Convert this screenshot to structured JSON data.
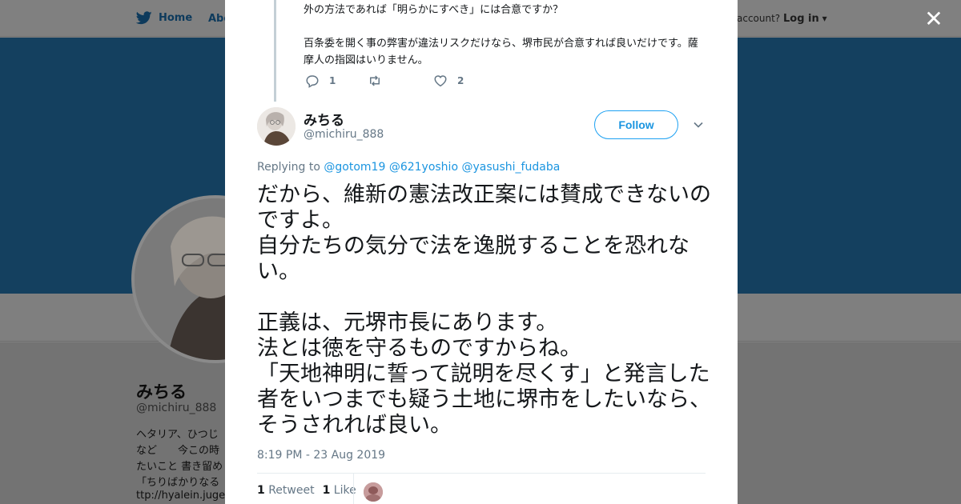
{
  "nav": {
    "home_label": "Home",
    "about_label": "Abo",
    "login_prefix": "account?",
    "login_label": "Log in"
  },
  "profile": {
    "name": "みちる",
    "handle": "@michiru_888",
    "bio": "ヘタリア、ひつじ\nなど　　今この時\nたいこと 書き留め\n「ちりばかりなる",
    "url": "ttp://hyalein.jugem"
  },
  "prev_tweet": {
    "text": "外の方法であれば「明らかにすべき」には合意ですか？\n\n百条委を開く事の弊害が違法リスクだけなら、堺市民が合意すれば良いだけです。薩摩人の指図はいりません。",
    "reply_count": "1",
    "retweet_count": "",
    "like_count": "2"
  },
  "tweet": {
    "author_name": "みちる",
    "author_handle": "@michiru_888",
    "follow_label": "Follow",
    "replying_prefix": "Replying to",
    "mentions": [
      "@gotom19",
      "@621yoshio",
      "@yasushi_fudaba"
    ],
    "text": "だから、維新の憲法改正案には賛成できないのですよ。\n自分たちの気分で法を逸脱することを恐れない。\n\n正義は、元堺市長にあります。\n法とは徳を守るものですからね。\n「天地神明に誓って説明を尽くす」と発言した者をいつまでも疑う土地に堺市をしたいなら、そうされれば良い。",
    "timestamp": "8:19 PM - 23 Aug 2019",
    "retweet_count": "1",
    "retweet_label": "Retweet",
    "like_count": "1",
    "like_label": "Like"
  },
  "colors": {
    "accent": "#1da1f2",
    "link": "#1b95e0",
    "muted": "#657786",
    "text": "#14171a",
    "banner": "#14405f"
  },
  "icons": {
    "brand": "twitter-bird-icon",
    "close": "close-icon",
    "reply": "reply-icon",
    "retweet": "retweet-icon",
    "like": "heart-icon",
    "more": "chevron-down-icon"
  }
}
